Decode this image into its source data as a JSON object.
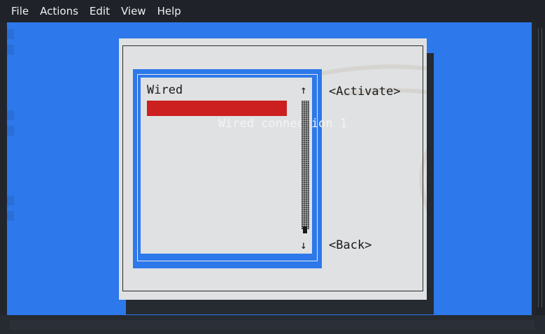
{
  "menubar": {
    "items": [
      "File",
      "Actions",
      "Edit",
      "View",
      "Help"
    ]
  },
  "dialog": {
    "list": {
      "group_label": "Wired",
      "selected_connection": "Wired connection 1",
      "scroll_up_glyph": "↑",
      "scroll_down_glyph": "↓"
    },
    "buttons": {
      "activate": "<Activate>",
      "back": "<Back>"
    }
  },
  "colors": {
    "terminal_bg": "#2d78ea",
    "dialog_bg": "#dfe1e2",
    "selection": "#cc1f1f",
    "menubar_bg": "#1f2329"
  }
}
